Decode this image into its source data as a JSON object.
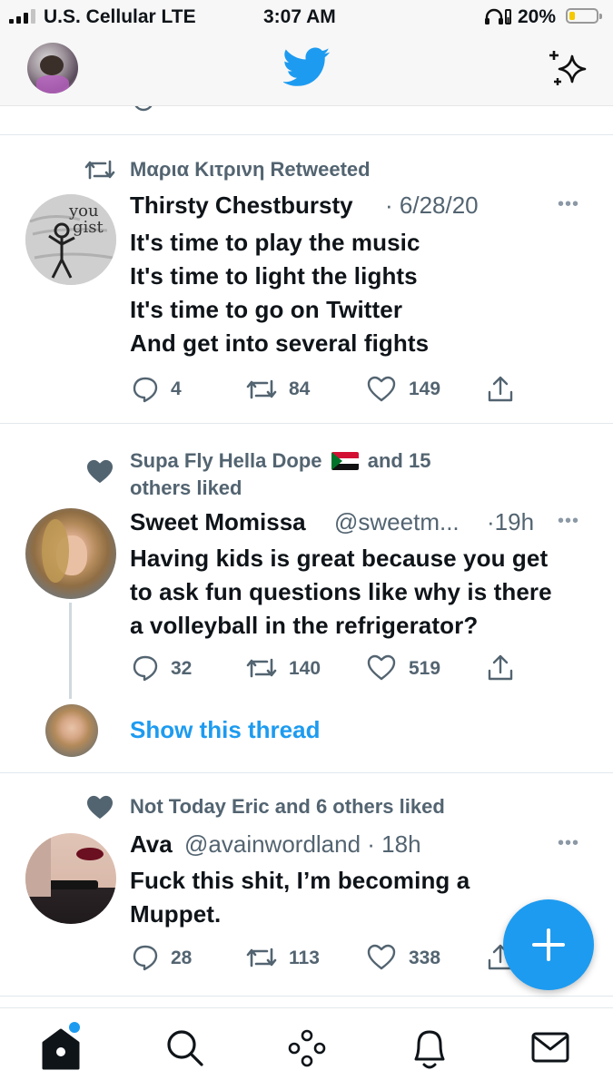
{
  "status_bar": {
    "carrier": "U.S. Cellular  LTE",
    "time": "3:07 AM",
    "battery": "20%",
    "battery_level": 0.2
  },
  "header": {
    "logo_icon": "twitter-bird-icon",
    "sparkle_icon": "sparkle-icon",
    "brand_color": "#1d9bf0"
  },
  "tweets": [
    {
      "context": "Μαρια Κιτρινη Retweeted",
      "name": "Thirsty Chestbursty",
      "meta": "· 6/28/20",
      "lines": [
        "It's time to play the music",
        "It's time to light the lights",
        "It's time to go on Twitter",
        "And get into several fights"
      ],
      "replies": "4",
      "retweets": "84",
      "likes": "149"
    },
    {
      "context_line1": "Supa Fly Hella Dope",
      "context_after_flag": "and 15",
      "context_line2": "others liked",
      "name": "Sweet Momissa",
      "handle": "@sweetm...",
      "time": "·19h",
      "lines": [
        "Having kids is great because you get",
        "to ask fun questions like why is there",
        "a volleyball in the refrigerator?"
      ],
      "replies": "32",
      "retweets": "140",
      "likes": "519",
      "thread_link": "Show this thread"
    },
    {
      "context": "Not Today Eric and 6 others liked",
      "name": "Ava",
      "meta": "@avainwordland · 18h",
      "lines": [
        "Fuck this shit, I’m becoming a",
        "Muppet."
      ],
      "replies": "28",
      "retweets": "113",
      "likes": "338"
    }
  ],
  "tab_bar": [
    "home-icon",
    "search-icon",
    "spaces-icon",
    "notifications-icon",
    "messages-icon"
  ]
}
